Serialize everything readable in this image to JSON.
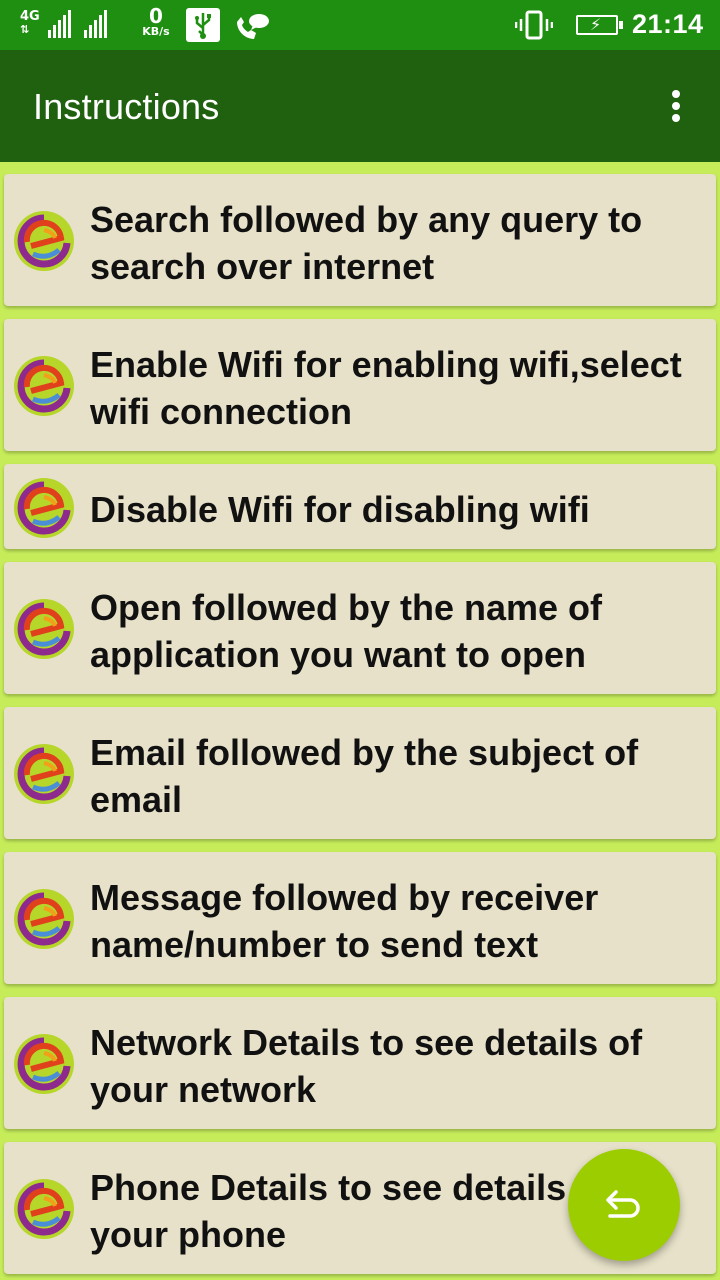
{
  "status_bar": {
    "network": "4G",
    "network_arrows": "⇅",
    "speed_value": "0",
    "speed_unit": "KB/s",
    "time": "21:14"
  },
  "toolbar": {
    "title": "Instructions"
  },
  "instructions": [
    "Search followed by any query to search over internet",
    "Enable Wifi for enabling wifi,select wifi connection",
    "Disable Wifi for disabling wifi",
    "Open followed by the name of application you want to open",
    "Email followed by the subject of email",
    "Message followed by receiver name/number to send text",
    "Network Details to see details of your network",
    "Phone Details to see details of your phone"
  ],
  "icons": {
    "item": "app-logo-icon",
    "fab": "undo-icon",
    "menu": "overflow-menu-icon"
  },
  "colors": {
    "status_bar": "#1e8f10",
    "toolbar": "#20610f",
    "background": "#c6ec5a",
    "card": "#e6e1c8",
    "fab": "#9ccd00"
  }
}
